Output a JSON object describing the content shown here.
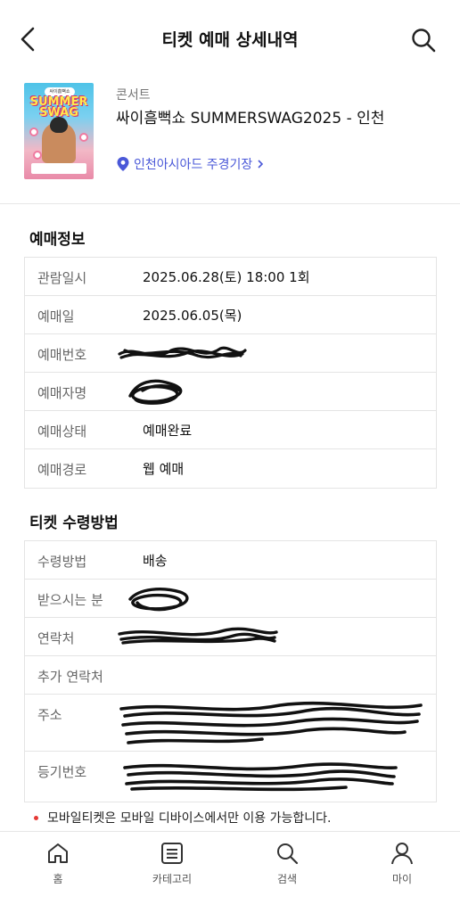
{
  "header": {
    "title": "티켓 예매 상세내역"
  },
  "product": {
    "category": "콘서트",
    "title": "싸이흠뻑쇼 SUMMERSWAG2025 - 인천",
    "venue": "인천아시아드 주경기장",
    "poster": {
      "badge": "싸이흠뻑쇼",
      "logo_line1": "SUMMER",
      "logo_line2": "SWAG"
    }
  },
  "booking_info": {
    "section_title": "예매정보",
    "rows": [
      {
        "label": "관람일시",
        "value": "2025.06.28(토) 18:00 1회"
      },
      {
        "label": "예매일",
        "value": "2025.06.05(목)"
      },
      {
        "label": "예매번호",
        "value": ""
      },
      {
        "label": "예매자명",
        "value": ""
      },
      {
        "label": "예매상태",
        "value": "예매완료"
      },
      {
        "label": "예매경로",
        "value": "웹 예매"
      }
    ]
  },
  "delivery_info": {
    "section_title": "티켓 수령방법",
    "rows": [
      {
        "label": "수령방법",
        "value": "배송"
      },
      {
        "label": "받으시는 분",
        "value": ""
      },
      {
        "label": "연락처",
        "value": ""
      },
      {
        "label": "추가 연락처",
        "value": ""
      },
      {
        "label": "주소",
        "value": ""
      },
      {
        "label": "등기번호",
        "value": ""
      }
    ]
  },
  "notice": "모바일티켓은 모바일 디바이스에서만 이용 가능합니다.",
  "bottom_nav": [
    {
      "label": "홈",
      "icon": "home-icon"
    },
    {
      "label": "카테고리",
      "icon": "list-icon"
    },
    {
      "label": "검색",
      "icon": "search-icon"
    },
    {
      "label": "마이",
      "icon": "person-icon"
    }
  ],
  "colors": {
    "accent": "#4a58d8",
    "notice_dot": "#e53935"
  }
}
